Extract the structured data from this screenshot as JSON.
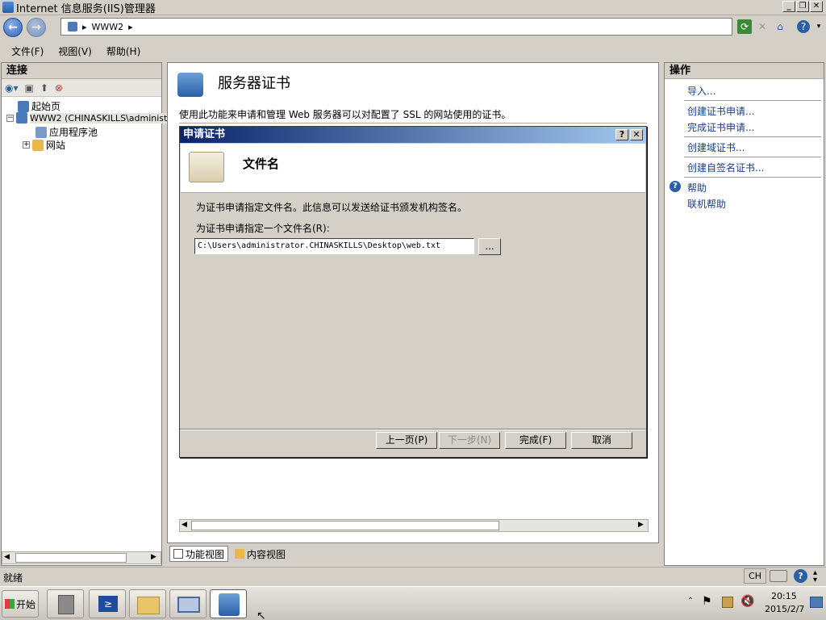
{
  "window": {
    "title": "Internet 信息服务(IIS)管理器"
  },
  "address": {
    "segments": [
      "WWW2"
    ]
  },
  "menu": {
    "items": [
      "文件(F)",
      "视图(V)",
      "帮助(H)"
    ]
  },
  "connections": {
    "heading": "连接",
    "tree": [
      {
        "label": "起始页"
      },
      {
        "label": "WWW2 (CHINASKILLS\\administ"
      },
      {
        "label": "应用程序池"
      },
      {
        "label": "网站"
      }
    ]
  },
  "center": {
    "title": "服务器证书",
    "description": "使用此功能来申请和管理 Web 服务器可以对配置了 SSL 的网站使用的证书。",
    "tabs": [
      "功能视图",
      "内容视图"
    ]
  },
  "dialog": {
    "title": "申请证书",
    "heading": "文件名",
    "description": "为证书申请指定文件名。此信息可以发送给证书颁发机构签名。",
    "field_label": "为证书申请指定一个文件名(R):",
    "field_value": "C:\\Users\\administrator.CHINASKILLS\\Desktop\\web.txt",
    "browse_label": "...",
    "buttons": {
      "prev": "上一页(P)",
      "next": "下一步(N)",
      "finish": "完成(F)",
      "cancel": "取消"
    }
  },
  "actions": {
    "heading": "操作",
    "items": [
      "导入...",
      "创建证书申请...",
      "完成证书申请...",
      "创建域证书...",
      "创建自签名证书...",
      "帮助",
      "联机帮助"
    ]
  },
  "status": {
    "text": "就绪",
    "lang": "CH"
  },
  "taskbar": {
    "start": "开始",
    "time": "20:15",
    "date": "2015/2/7"
  },
  "colors": {
    "titlebar": "#0a246a",
    "link": "#1a3c8c"
  }
}
